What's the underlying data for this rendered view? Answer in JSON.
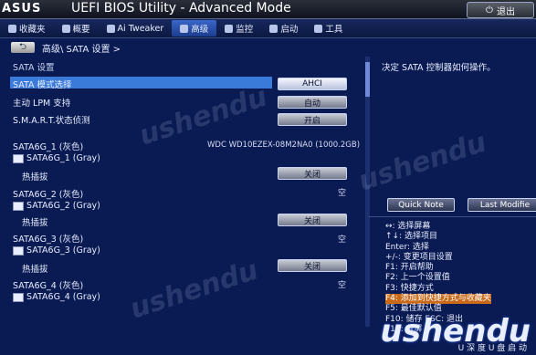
{
  "header": {
    "brand": "ASUS",
    "title": "UEFI BIOS Utility - Advanced Mode",
    "exit_label": "退出"
  },
  "tabs": [
    {
      "label": "收藏夹",
      "icon": "star-icon"
    },
    {
      "label": "概要",
      "icon": "list-icon"
    },
    {
      "label": "Ai Tweaker",
      "icon": "tweaker-icon"
    },
    {
      "label": "高级",
      "icon": "advanced-icon",
      "active": true
    },
    {
      "label": "监控",
      "icon": "monitor-icon"
    },
    {
      "label": "启动",
      "icon": "power-icon"
    },
    {
      "label": "工具",
      "icon": "tool-icon"
    }
  ],
  "breadcrumb": {
    "back_label": "⮌",
    "path": "高级\\ SATA 设置 >"
  },
  "section_title": "SATA 设置",
  "settings": {
    "mode_label": "SATA 模式选择",
    "mode_value": "AHCI",
    "lpm_label": "主动 LPM 支持",
    "lpm_value": "自动",
    "smart_label": "S.M.A.R.T.状态侦测",
    "smart_value": "开启"
  },
  "ports": [
    {
      "name": "SATA6G_1 (灰色)",
      "sub": "SATA6G_1 (Gray)",
      "device": "WDC WD10EZEX-08M2NA0 (1000.2GB)",
      "hotplug_label": "热插拔",
      "hotplug_value": "关闭"
    },
    {
      "name": "SATA6G_2 (灰色)",
      "sub": "SATA6G_2 (Gray)",
      "device": "空",
      "hotplug_label": "热插拔",
      "hotplug_value": "关闭"
    },
    {
      "name": "SATA6G_3 (灰色)",
      "sub": "SATA6G_3 (Gray)",
      "device": "空",
      "hotplug_label": "热插拔",
      "hotplug_value": "关闭"
    },
    {
      "name": "SATA6G_4 (灰色)",
      "sub": "SATA6G_4 (Gray)",
      "device": "空"
    }
  ],
  "help": {
    "text": "决定 SATA 控制器如何操作。",
    "quick_note": "Quick Note",
    "last_modified": "Last Modifie"
  },
  "keys": [
    "↔: 选择屏幕",
    "↑↓: 选择项目",
    "Enter: 选择",
    "+/-: 变更项目设置",
    "F1: 开启帮助",
    "F2: 上一个设置值",
    "F3: 快捷方式",
    "F4: 添加到快捷方式与收藏夹",
    "F5: 最佳默认值",
    "F10: 储存  ESC: 退出",
    "F12: 截屏"
  ],
  "watermark": {
    "brand": "ushendu",
    "sub": "U 深 度 U 盘 启 动"
  }
}
